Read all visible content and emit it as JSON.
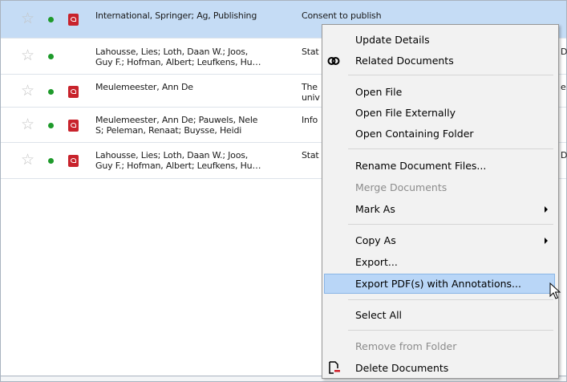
{
  "rows": [
    {
      "authors": "International, Springer; Ag, Publishing",
      "title": "Consent to publish",
      "has_pdf": true,
      "selected": true
    },
    {
      "authors": "Lahousse, Lies; Loth, Daan W.; Joos,\nGuy F.; Hofman, Albert; Leufkens, Hu…",
      "title": "Stat",
      "has_pdf": false,
      "selected": false
    },
    {
      "authors": "Meulemeester, Ann De",
      "title": "The\nuniv",
      "has_pdf": true,
      "selected": false
    },
    {
      "authors": "Meulemeester, Ann De; Pauwels, Nele\nS; Peleman, Renaat; Buysse, Heidi",
      "title": "Info",
      "has_pdf": true,
      "selected": false
    },
    {
      "authors": "Lahousse, Lies; Loth, Daan W.; Joos,\nGuy F.; Hofman, Albert; Leufkens, Hu…",
      "title": "Stat",
      "has_pdf": true,
      "selected": false
    }
  ],
  "right_edge_fragments": [
    "D",
    "e",
    "D"
  ],
  "menu": {
    "update_details": "Update Details",
    "related_documents": "Related Documents",
    "open_file": "Open File",
    "open_file_externally": "Open File Externally",
    "open_containing_folder": "Open Containing Folder",
    "rename_document_files": "Rename Document Files...",
    "merge_documents": "Merge Documents",
    "mark_as": "Mark As",
    "copy_as": "Copy As",
    "export": "Export...",
    "export_pdfs": "Export PDF(s) with Annotations...",
    "select_all": "Select All",
    "remove_from_folder": "Remove from Folder",
    "delete_documents": "Delete Documents"
  },
  "colors": {
    "selected_row": "#c5dcf5",
    "menu_highlight": "#b9d6f7",
    "status_dot": "#1e9a2b",
    "pdf_icon": "#c8232c"
  }
}
